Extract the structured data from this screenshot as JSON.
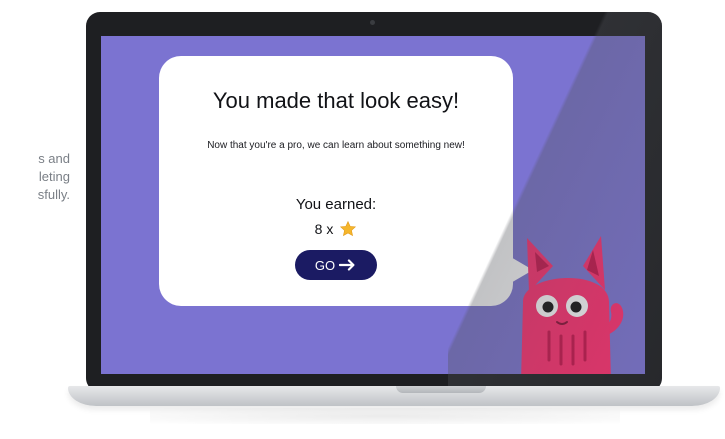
{
  "side_text": {
    "line1": "s and",
    "line2": "leting",
    "line3": "sfully."
  },
  "screen": {
    "background_color": "#7b73d1",
    "card": {
      "title": "You made that look easy!",
      "subtitle": "Now that you're a pro, we can learn about something new!",
      "earned_label": "You earned:",
      "reward_count": "8 x",
      "reward_icon": "star-icon",
      "go_button_label": "GO",
      "go_button_icon": "arrow-right-icon",
      "go_button_color": "#1b1b63"
    },
    "mascot": {
      "icon": "pink-cat-mascot",
      "color": "#ff2d6e"
    }
  },
  "colors": {
    "star": "#f5b62c",
    "laptop_bezel": "#1e1f22"
  }
}
